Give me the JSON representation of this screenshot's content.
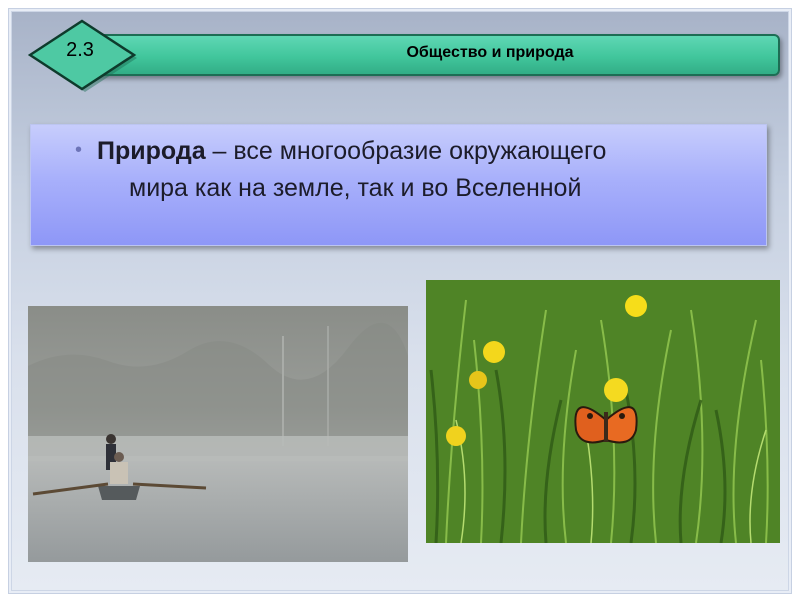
{
  "slide": {
    "number": "2.3",
    "title": "Общество и природа"
  },
  "definition": {
    "term": "Природа",
    "text_line1": " – все многообразие окружающего",
    "text_line2": "мира как на земле, так и во Вселенной"
  },
  "photos": {
    "left_icon": "foggy-lake-boat-photo",
    "right_icon": "butterfly-meadow-photo"
  },
  "colors": {
    "title_bar": "#41c69c",
    "definition_box": "#a8b0fb"
  }
}
